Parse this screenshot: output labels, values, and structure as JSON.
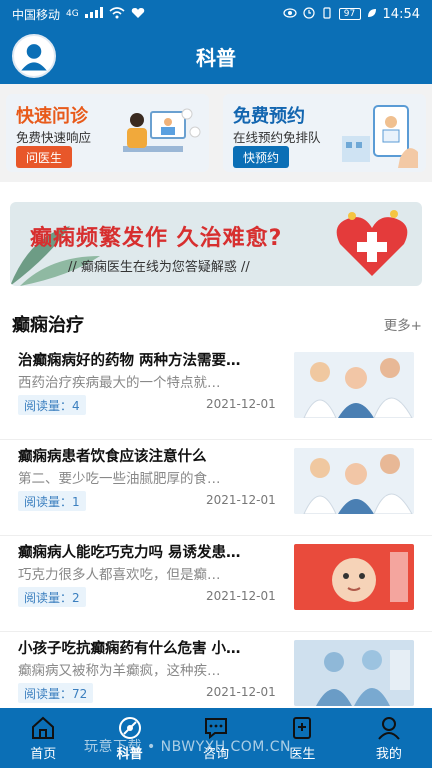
{
  "status_bar": {
    "carrier": "中国移动",
    "network": "4G",
    "battery": "97",
    "time": "14:54"
  },
  "header": {
    "title": "科普"
  },
  "quick_cards": [
    {
      "title": "快速问诊",
      "subtitle": "免费快速响应",
      "button": "问医生",
      "icon": "doctor-consult-icon"
    },
    {
      "title": "免费预约",
      "subtitle": "在线预约免排队",
      "button": "快预约",
      "icon": "phone-appointment-icon"
    }
  ],
  "banner": {
    "headline": "癫痫频繁发作  久治难愈?",
    "subline": "// 癫痫医生在线为您答疑解惑 //"
  },
  "section": {
    "title": "癫痫治疗",
    "more": "更多+"
  },
  "articles": [
    {
      "title": "治癫痫病好的药物 两种方法需要…",
      "excerpt": "西药治疗疾病最大的一个特点就…",
      "reads": "阅读量：4",
      "date": "2021-12-01",
      "thumb": "doctor-with-elderly-patient"
    },
    {
      "title": "癫痫病患者饮食应该注意什么",
      "excerpt": "第二、要少吃一些油腻肥厚的食…",
      "reads": "阅读量：1",
      "date": "2021-12-01",
      "thumb": "doctor-with-elderly-patient"
    },
    {
      "title": "癫痫病人能吃巧克力吗 易诱发患…",
      "excerpt": "巧克力很多人都喜欢吃，但是癫…",
      "reads": "阅读量：2",
      "date": "2021-12-01",
      "thumb": "baby-photo"
    },
    {
      "title": "小孩子吃抗癫痫药有什么危害 小…",
      "excerpt": "癫痫病又被称为羊癫疯，这种疾…",
      "reads": "阅读量：72",
      "date": "2021-12-01",
      "thumb": "surgery-team"
    }
  ],
  "bottom_nav": [
    {
      "label": "首页",
      "icon": "home-icon",
      "active": false
    },
    {
      "label": "科普",
      "icon": "science-icon",
      "active": true
    },
    {
      "label": "咨询",
      "icon": "chat-icon",
      "active": false
    },
    {
      "label": "医生",
      "icon": "doctor-icon",
      "active": false
    },
    {
      "label": "我的",
      "icon": "profile-icon",
      "active": false
    }
  ],
  "watermark": "玩意下载 • NBWYXH.COM.CN",
  "colors": {
    "primary": "#0b6fb6",
    "accent_orange": "#e85a1a",
    "accent_red": "#d72f2f"
  }
}
